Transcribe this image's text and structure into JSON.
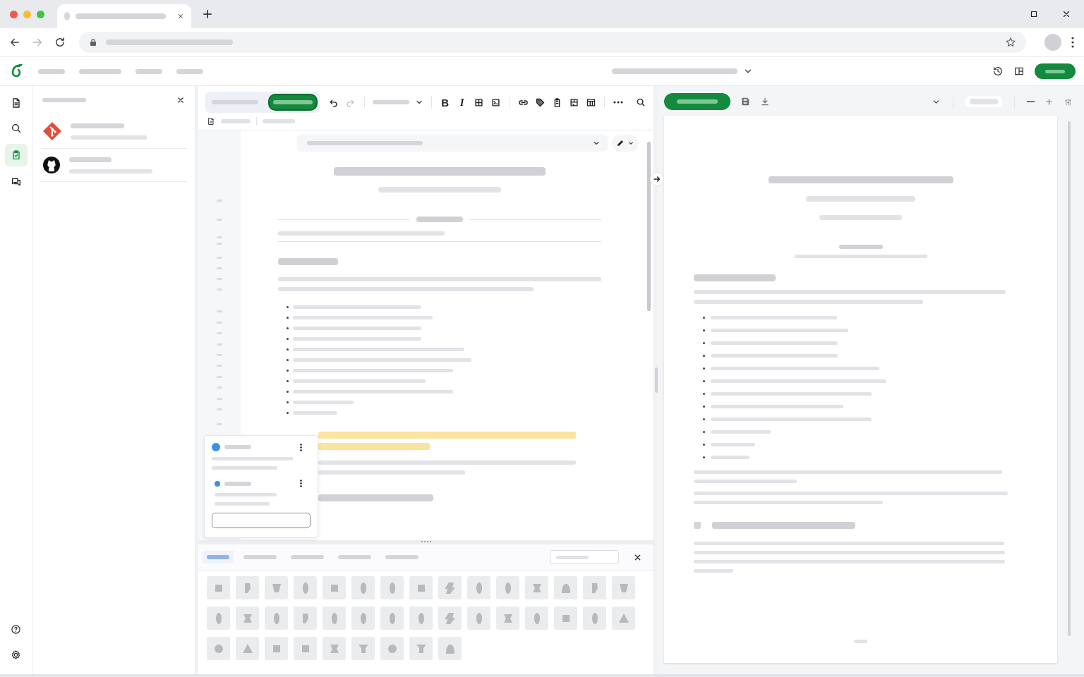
{
  "browser_tabs": [
    {
      "selected": true
    }
  ],
  "nav_buttons": [
    {
      "kind": "back",
      "disabled": false
    },
    {
      "kind": "forward",
      "disabled": true
    },
    {
      "kind": "reload",
      "disabled": false
    }
  ],
  "rail": [
    {
      "kind": "file",
      "selected": false
    },
    {
      "kind": "search",
      "selected": false
    },
    {
      "kind": "integrations",
      "selected": true
    },
    {
      "kind": "chat",
      "selected": false
    }
  ],
  "rail_bottom": [
    {
      "kind": "help"
    },
    {
      "kind": "settings"
    }
  ],
  "integrations": [
    {
      "kind": "git"
    },
    {
      "kind": "github"
    }
  ],
  "editor_mode": [
    {
      "selected": false
    },
    {
      "selected": true
    }
  ],
  "toolbar": [
    {
      "kind": "undo",
      "disabled": false
    },
    {
      "kind": "redo",
      "disabled": true
    },
    {
      "kind": "style_menu"
    },
    {
      "kind": "bold",
      "label": "B"
    },
    {
      "kind": "italic",
      "label": "I"
    },
    {
      "kind": "grid"
    },
    {
      "kind": "terminal"
    },
    {
      "kind": "link"
    },
    {
      "kind": "tag"
    },
    {
      "kind": "clipboard"
    },
    {
      "kind": "figure"
    },
    {
      "kind": "table"
    },
    {
      "kind": "more"
    }
  ],
  "symbol_tabs": [
    {
      "selected": true
    },
    {
      "selected": false
    },
    {
      "selected": false
    },
    {
      "selected": false
    },
    {
      "selected": false
    }
  ]
}
